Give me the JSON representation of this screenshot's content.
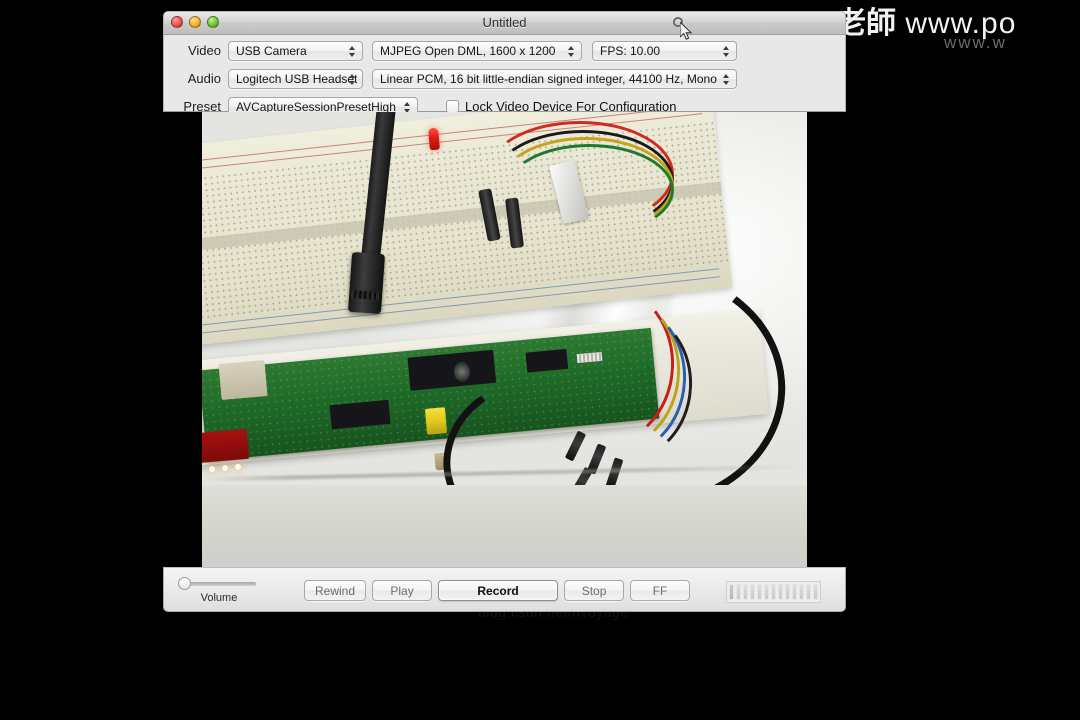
{
  "window": {
    "title": "Untitled",
    "traffic_lights": [
      "close",
      "minimize",
      "zoom"
    ],
    "toolbar_icon": "search-icon"
  },
  "settings": {
    "rows": [
      {
        "label": "Video",
        "controls": [
          {
            "type": "popup",
            "name": "video-device-popup",
            "value": "USB Camera"
          },
          {
            "type": "popup",
            "name": "video-format-popup",
            "value": "MJPEG Open DML, 1600 x 1200"
          },
          {
            "type": "popup",
            "name": "video-fps-popup",
            "value": "FPS: 10.00"
          }
        ]
      },
      {
        "label": "Audio",
        "controls": [
          {
            "type": "popup",
            "name": "audio-device-popup",
            "value": "Logitech USB Headset"
          },
          {
            "type": "popup",
            "name": "audio-format-popup",
            "value": "Linear PCM, 16 bit little-endian signed integer, 44100 Hz, Mono"
          }
        ]
      },
      {
        "label": "Preset",
        "controls": [
          {
            "type": "popup",
            "name": "preset-popup",
            "value": "AVCaptureSessionPresetHigh"
          },
          {
            "type": "checkbox",
            "name": "lock-video-device-checkbox",
            "label": "Lock Video Device For Configuration",
            "checked": false
          }
        ]
      }
    ]
  },
  "preview": {
    "subject": "Raspberry Pi board on a breadboard with HDMI cable and colored jumper wires on white paper"
  },
  "transport": {
    "volume_label": "Volume",
    "volume_value": 0,
    "buttons": [
      {
        "name": "rewind-button",
        "label": "Rewind",
        "primary": false
      },
      {
        "name": "play-button",
        "label": "Play",
        "primary": false
      },
      {
        "name": "record-button",
        "label": "Record",
        "primary": true
      },
      {
        "name": "stop-button",
        "label": "Stop",
        "primary": false
      },
      {
        "name": "ff-button",
        "label": "FF",
        "primary": false
      }
    ],
    "level_meter_segments": 13,
    "level_meter_lit": 1
  },
  "watermarks": {
    "top_cjk": "老師",
    "top_url": "www.po",
    "top_small": "www.w",
    "bottom": "blog.csdn.net/hvoyage"
  },
  "colors": {
    "desktop_background": "#000000",
    "panel_background": "#e8e8e8",
    "titlebar_background": "#c9c9c9",
    "close_light": "#e8564a",
    "minimize_light": "#f0b02e",
    "zoom_light": "#73c434",
    "led_red": "#e01a14",
    "pi_green": "#1e6a28"
  }
}
